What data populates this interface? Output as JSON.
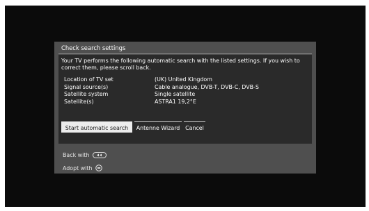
{
  "dialog": {
    "title": "Check search settings",
    "intro_line1": "Your TV performs the following automatic search with the listed settings. If you wish to",
    "intro_line2": "correct them, please scroll back.",
    "settings": [
      {
        "label": "Location of TV set",
        "value": "(UK) United Kingdom"
      },
      {
        "label": "Signal source(s)",
        "value": "Cable analogue, DVB-T, DVB-C, DVB-S"
      },
      {
        "label": "Satellite system",
        "value": "Single satellite"
      },
      {
        "label": "Satellite(s)",
        "value": "ASTRA1 19,2°E"
      }
    ],
    "buttons": {
      "start": "Start automatic search",
      "antenna": "Antenne Wizard",
      "cancel": "Cancel"
    },
    "selected_button": "start"
  },
  "hints": {
    "back": "Back with",
    "back_icon": "back-key-icon",
    "adopt": "Adopt with",
    "adopt_icon": "ok-key-icon"
  },
  "colors": {
    "screen_bg": "#0b0b0b",
    "dialog_bg": "#4f4f4f",
    "panel_bg": "#2a2a2a",
    "selected_button_bg": "#ededed"
  }
}
